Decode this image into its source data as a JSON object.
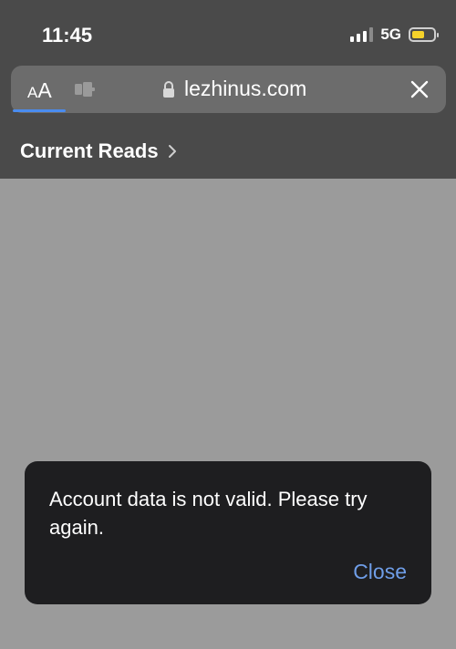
{
  "status_bar": {
    "time": "11:45",
    "network": "5G",
    "signal_bars_active": 3,
    "battery_level": 0.6,
    "battery_color": "#f5d22a"
  },
  "address_bar": {
    "text_size_small": "A",
    "text_size_big": "A",
    "url": "lezhinus.com",
    "progress_color": "#4a8cf0"
  },
  "breadcrumb": {
    "title": "Current Reads"
  },
  "toast": {
    "message": "Account data is not valid. Please try again.",
    "close_label": "Close",
    "close_color": "#6f9ee8"
  }
}
